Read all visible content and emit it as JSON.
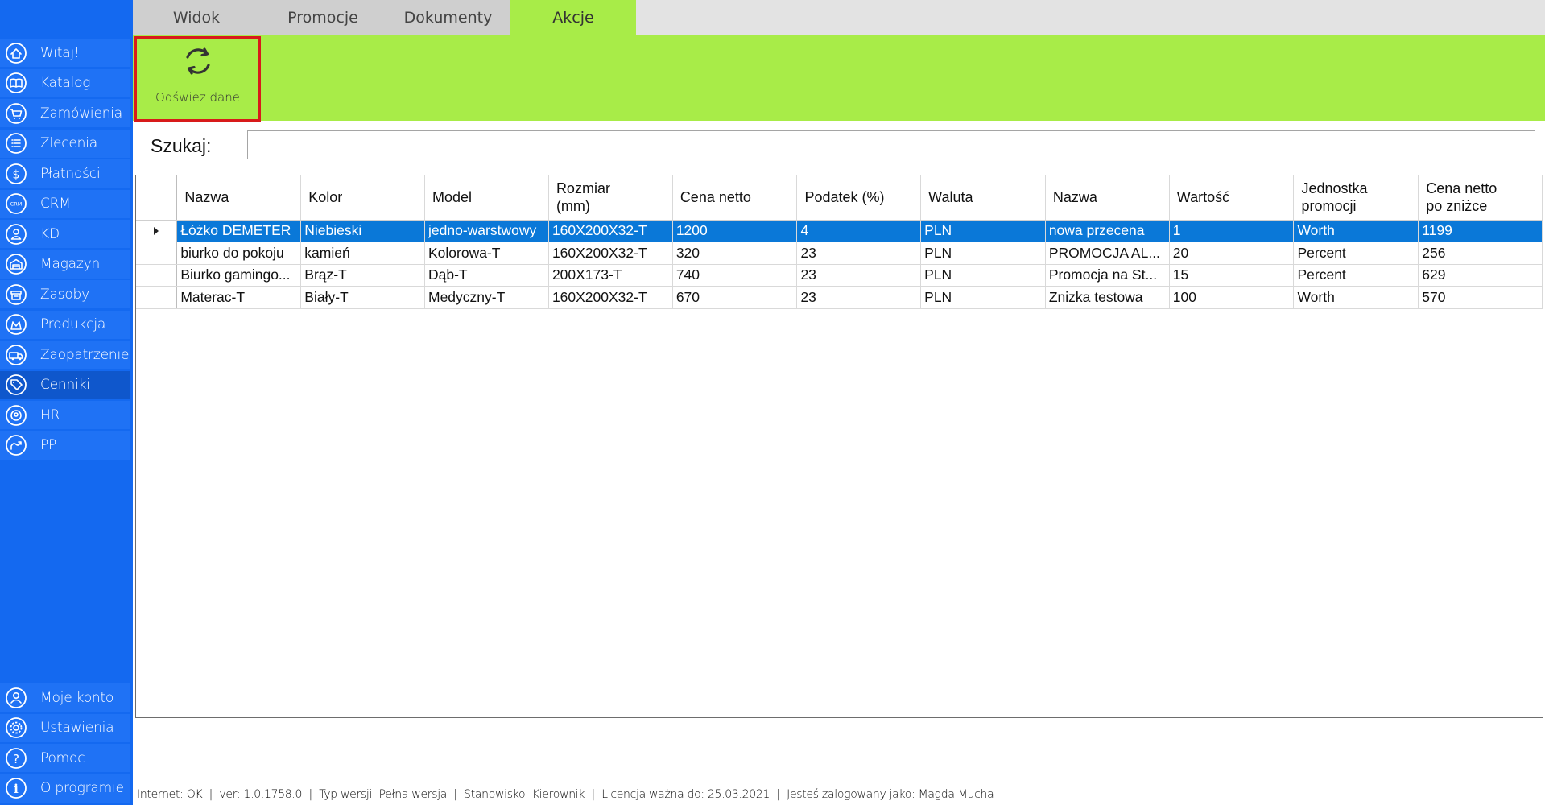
{
  "sidebar": {
    "items": [
      {
        "label": "Witaj!",
        "icon": "home-icon"
      },
      {
        "label": "Katalog",
        "icon": "book-icon"
      },
      {
        "label": "Zamówienia",
        "icon": "cart-icon"
      },
      {
        "label": "Zlecenia",
        "icon": "list-icon"
      },
      {
        "label": "Płatności",
        "icon": "dollar-icon"
      },
      {
        "label": "CRM",
        "icon": "crm-icon"
      },
      {
        "label": "KD",
        "icon": "person-icon"
      },
      {
        "label": "Magazyn",
        "icon": "warehouse-icon"
      },
      {
        "label": "Zasoby",
        "icon": "box-icon"
      },
      {
        "label": "Produkcja",
        "icon": "production-icon"
      },
      {
        "label": "Zaopatrzenie",
        "icon": "truck-icon"
      },
      {
        "label": "Cenniki",
        "icon": "tag-icon"
      },
      {
        "label": "HR",
        "icon": "hr-icon"
      },
      {
        "label": "PP",
        "icon": "pp-icon"
      }
    ],
    "active_index": 11,
    "bottom_items": [
      {
        "label": "Moje konto",
        "icon": "account-icon"
      },
      {
        "label": "Ustawienia",
        "icon": "gear-icon"
      },
      {
        "label": "Pomoc",
        "icon": "help-icon"
      },
      {
        "label": "O programie",
        "icon": "info-icon"
      }
    ]
  },
  "tabs": [
    {
      "label": "Widok"
    },
    {
      "label": "Promocje"
    },
    {
      "label": "Dokumenty"
    },
    {
      "label": "Akcje"
    }
  ],
  "active_tab": 3,
  "ribbon": {
    "refresh_label": "Odśwież dane",
    "refresh_icon": "refresh-icon"
  },
  "search": {
    "label": "Szukaj:",
    "value": ""
  },
  "grid": {
    "columns": [
      "Nazwa",
      "Kolor",
      "Model",
      "Rozmiar\n(mm)",
      "Cena netto",
      "Podatek (%)",
      "Waluta",
      "Nazwa",
      "Wartość",
      "Jednostka\npromocji",
      "Cena netto\npo zniżce"
    ],
    "rows": [
      [
        "Łóżko DEMETER",
        "Niebieski",
        "jedno-warstwowy",
        "160X200X32-T",
        "1200",
        "4",
        "PLN",
        "nowa przecena",
        "1",
        "Worth",
        "1199"
      ],
      [
        "biurko do pokoju",
        "kamień",
        "Kolorowa-T",
        "160X200X32-T",
        "320",
        "23",
        "PLN",
        "PROMOCJA AL...",
        "20",
        "Percent",
        "256"
      ],
      [
        "Biurko gamingo...",
        "Brąz-T",
        "Dąb-T",
        "200X173-T",
        "740",
        "23",
        "PLN",
        "Promocja na St...",
        "15",
        "Percent",
        "629"
      ],
      [
        "Materac-T",
        "Biały-T",
        "Medyczny-T",
        "160X200X32-T",
        "670",
        "23",
        "PLN",
        "Znizka testowa",
        "100",
        "Worth",
        "570"
      ]
    ],
    "selected_row": 0
  },
  "status": {
    "items": [
      "Internet: OK",
      "ver: 1.0.1758.0",
      "Typ wersji: Pełna wersja",
      "Stanowisko: Kierownik",
      "Licencja ważna do: 25.03.2021",
      "Jesteś zalogowany jako: Magda Mucha"
    ]
  },
  "colors": {
    "sidebar": "#1469f0",
    "accent_green": "#a8ec48",
    "selection": "#0a78d8",
    "highlight_border": "#d81a1a"
  }
}
